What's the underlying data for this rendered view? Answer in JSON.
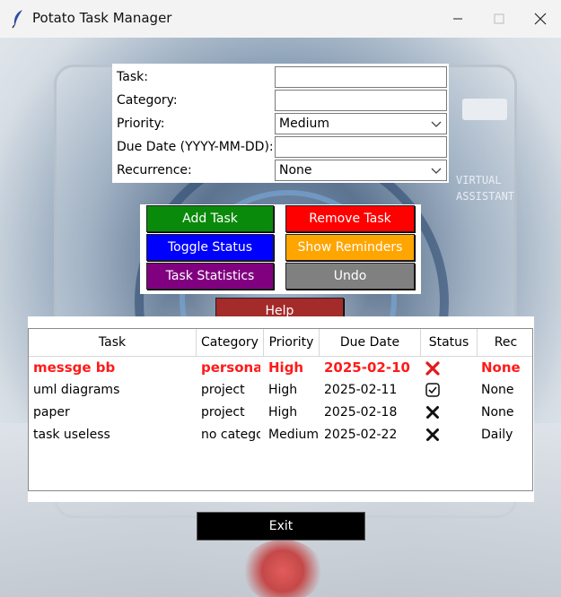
{
  "window": {
    "title": "Potato Task Manager"
  },
  "background": {
    "sign_text_1": "VIRTUAL",
    "sign_text_2": "ASSISTANT"
  },
  "form": {
    "task_label": "Task:",
    "task_value": "",
    "category_label": "Category:",
    "category_value": "",
    "priority_label": "Priority:",
    "priority_value": "Medium",
    "due_label": "Due Date (YYYY-MM-DD):",
    "due_value": "",
    "recurrence_label": "Recurrence:",
    "recurrence_value": "None"
  },
  "buttons": {
    "add": "Add Task",
    "remove": "Remove Task",
    "toggle": "Toggle Status",
    "reminders": "Show Reminders",
    "stats": "Task Statistics",
    "undo": "Undo",
    "help": "Help",
    "exit": "Exit"
  },
  "table": {
    "headers": [
      "Task",
      "Category",
      "Priority",
      "Due Date",
      "Status",
      "Rec"
    ],
    "rows": [
      {
        "task": "messge  bb",
        "category": "personal",
        "priority": "High",
        "due": "2025-02-10",
        "status": "cross-red",
        "rec": "None",
        "overdue": true
      },
      {
        "task": "uml diagrams",
        "category": "project",
        "priority": "High",
        "due": "2025-02-11",
        "status": "check-box",
        "rec": "None",
        "overdue": false
      },
      {
        "task": "paper",
        "category": "project",
        "priority": "High",
        "due": "2025-02-18",
        "status": "cross-black",
        "rec": "None",
        "overdue": false
      },
      {
        "task": "task useless",
        "category": "no category",
        "priority": "Medium",
        "due": "2025-02-22",
        "status": "cross-black",
        "rec": "Daily",
        "overdue": false
      }
    ]
  },
  "colors": {
    "add": "#0a8a0a",
    "remove": "#ff0000",
    "toggle": "#0000ff",
    "reminders": "#ffa500",
    "stats": "#800080",
    "undo": "#808080",
    "help": "#a52a2a",
    "exit": "#000000",
    "overdue_text": "#ff1a1a"
  }
}
